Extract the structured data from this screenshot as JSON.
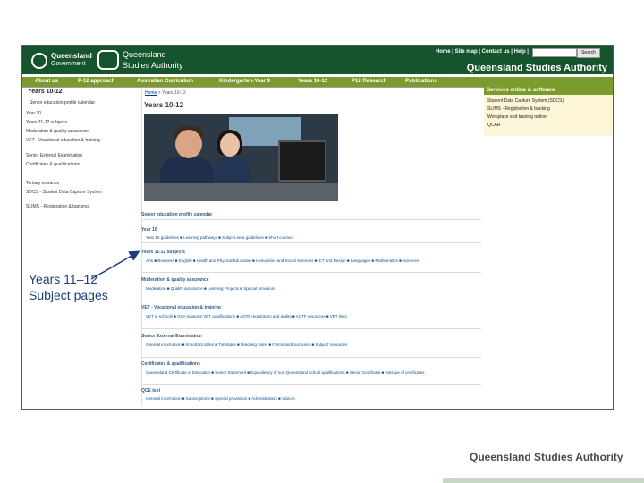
{
  "header": {
    "gov_logo_line1": "Queensland",
    "gov_logo_line2": "Government",
    "qsa_logo_line1": "Queensland",
    "qsa_logo_line2": "Studies Authority",
    "top_links": "Home | Site map | Contact us | Help |",
    "search_button": "Search",
    "brand": "Queensland Studies Authority"
  },
  "nav": {
    "items": [
      "About us",
      "P-12 approach",
      "Australian Curriculum",
      "Kindergarten-Year 9",
      "Years 10-12",
      "P12 Research",
      "Publications"
    ]
  },
  "sidebar": {
    "heading": "Years 10-12",
    "items": [
      "Senior education profile calendar",
      "Year 10",
      "Years 11-12 subjects",
      "Moderation & quality assurance",
      "VET - Vocational education & training",
      "Senior External Examination",
      "Certificates & qualifications",
      "Tertiary entrance",
      "SDCS - Student Data Capture System",
      "SLIMS - Registration & banking"
    ]
  },
  "breadcrumb": {
    "home": "Home",
    "current": "> Years 10-12"
  },
  "page_title": "Years 10-12",
  "services": {
    "title": "Services online & software",
    "items": [
      "Student Data Capture System (SDCS)",
      "SLIMS - Registration & banking",
      "Workplace and training online",
      "QCAR"
    ]
  },
  "sections": [
    {
      "title": "Senior education profile calendar",
      "links": ""
    },
    {
      "title": "Year 10",
      "links": "Year 10 guidelines  ■ Learning pathways  ■ Subject area guidelines  ■ Short courses"
    },
    {
      "title": "Years 11-12 subjects",
      "links": "Arts  ■ Business  ■ English  ■ Health and Physical Education  ■ Humanities and Social Sciences  ■ ICT and Design  ■ Languages  ■ Mathematics  ■ Sciences"
    },
    {
      "title": "Moderation & quality assurance",
      "links": "Moderation  ■ Quality assurance  ■ Learning Projects  ■ Special provisions"
    },
    {
      "title": "VET - Vocational education & training",
      "links": "VET in schools  ■ QSA supports VET qualifications  ■ AQTF registration and audits  ■ AQTF resources  ■ VET links"
    },
    {
      "title": "Senior External Examination",
      "links": "General information  ■ Important dates  ■ Timetable  ■ Teaching notes  ■ Forms and brochures  ■ Subject resources"
    },
    {
      "title": "Certificates & qualifications",
      "links": "Queensland Certificate of Education  ■ Senior Statement  ■ Equivalency of non-Queensland school qualifications  ■ Senior Certificate  ■ Reissue of certificates"
    },
    {
      "title": "QCE test",
      "links": "General information  ■ Subscriptions  ■ Special provisions  ■ Administration  ■ Visitors"
    }
  ],
  "annotation": {
    "line1": "Years 11–12",
    "line2": "Subject pages"
  },
  "footer": {
    "brand": "Queensland Studies Authority"
  },
  "colors": {
    "header_green": "#16542d",
    "nav_green": "#7b9c2c",
    "link_blue": "#0d4d8f",
    "annotation_blue": "#1e3d7a"
  }
}
